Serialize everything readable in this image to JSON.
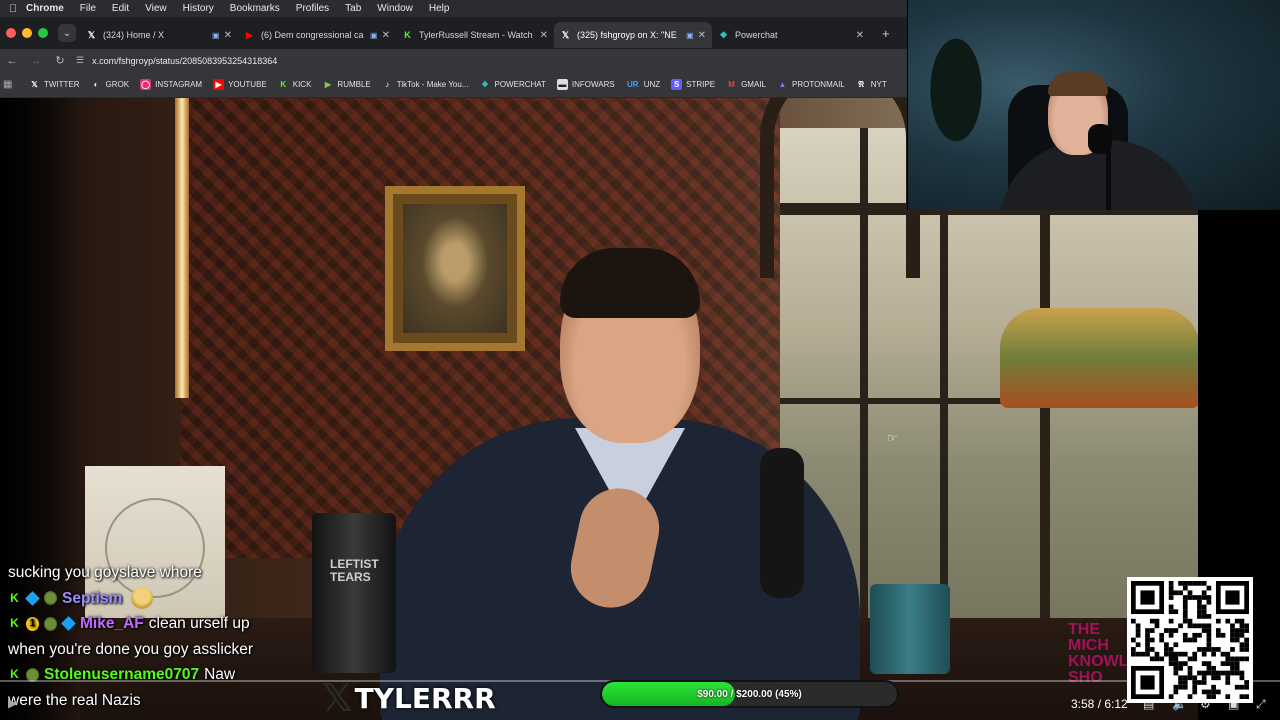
{
  "menubar": {
    "items": [
      "Chrome",
      "File",
      "Edit",
      "View",
      "History",
      "Bookmarks",
      "Profiles",
      "Tab",
      "Window",
      "Help"
    ]
  },
  "tabs": [
    {
      "title": "(324) Home / X",
      "icon": "x-icon",
      "active": false
    },
    {
      "title": "(6) Dem congressional ca",
      "icon": "youtube-icon",
      "active": false
    },
    {
      "title": "TylerRussell Stream - Watch L",
      "icon": "kick-icon",
      "active": false
    },
    {
      "title": "(325) fshgroyp on X: \"NE",
      "icon": "x-icon",
      "active": true
    },
    {
      "title": "Powerchat",
      "icon": "powerchat-icon",
      "active": false
    }
  ],
  "toolbar": {
    "url": "x.com/fshgroyp/status/2085083953254318364"
  },
  "bookmarks": [
    {
      "label": "TWITTER",
      "icon": "x-icon",
      "color": "#ffffff"
    },
    {
      "label": "GROK",
      "icon": "grok-icon",
      "color": "#ffffff"
    },
    {
      "label": "INSTAGRAM",
      "icon": "instagram-icon",
      "color": "#e1306c"
    },
    {
      "label": "YOUTUBE",
      "icon": "youtube-icon",
      "color": "#ff0000"
    },
    {
      "label": "KICK",
      "icon": "kick-icon",
      "color": "#53fc18"
    },
    {
      "label": "RUMBLE",
      "icon": "rumble-icon",
      "color": "#85c742"
    },
    {
      "label": "TikTok - Make You...",
      "icon": "tiktok-icon",
      "color": "#ffffff"
    },
    {
      "label": "POWERCHAT",
      "icon": "powerchat-icon",
      "color": "#33c3c3"
    },
    {
      "label": "INFOWARS",
      "icon": "infowars-icon",
      "color": "#dddddd"
    },
    {
      "label": "UNZ",
      "icon": "unz-icon",
      "color": "#3aa0ff"
    },
    {
      "label": "STRIPE",
      "icon": "stripe-icon",
      "color": "#635bff"
    },
    {
      "label": "GMAIL",
      "icon": "gmail-icon",
      "color": "#ea4335"
    },
    {
      "label": "PROTONMAIL",
      "icon": "protonmail-icon",
      "color": "#8b6cff"
    },
    {
      "label": "NYT",
      "icon": "nyt-icon",
      "color": "#ffffff"
    }
  ],
  "video": {
    "tumbler_text": "LEFTIST\nTEARS",
    "watermark": "THE\nMICH\nKNOWL\nSHO"
  },
  "chat": [
    {
      "name": "",
      "text": "sucking you goyslave whore",
      "badges": [],
      "name_color": "#ffffff"
    },
    {
      "name": "Septism",
      "text": "",
      "badges": [
        "kick",
        "cube",
        "turtle"
      ],
      "emote": true,
      "name_color": "#9b8cff"
    },
    {
      "name": "Mike_AF",
      "text": "clean urself up",
      "badges": [
        "kick",
        "one",
        "turtle",
        "cube"
      ],
      "name_color": "#c06bff"
    },
    {
      "name": "",
      "text": "when you're done you goy asslicker",
      "badges": [],
      "name_color": "#ffffff"
    },
    {
      "name": "Stolenusername0707",
      "text": "Naw",
      "badges": [
        "kick",
        "turtle"
      ],
      "name_color": "#53fc18"
    },
    {
      "name": "",
      "text": "were the real Nazis",
      "badges": [],
      "name_color": "#ffffff"
    }
  ],
  "overlay": {
    "logo_text": "TYLERRR",
    "goal": {
      "raised_label": "$90.00",
      "separator": " / ",
      "target_label": "$200.00 (45%)",
      "fraction": 0.45
    }
  },
  "player": {
    "time": "3:58 / 6:12"
  }
}
